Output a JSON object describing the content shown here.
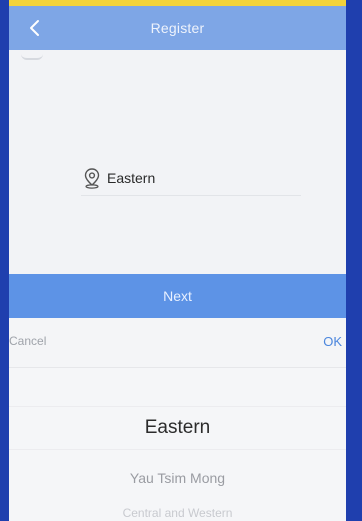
{
  "header": {
    "title": "Register"
  },
  "form": {
    "district_value": "Eastern"
  },
  "actions": {
    "next_label": "Next"
  },
  "picker": {
    "cancel_label": "Cancel",
    "ok_label": "OK",
    "options": [
      "Eastern",
      "Yau Tsim Mong",
      "Central and Western"
    ],
    "selected_index": 0
  },
  "icons": {
    "back": "chevron-left-icon",
    "location": "location-pin-icon"
  },
  "colors": {
    "frame": "#1f3fae",
    "frame_top": "#f3d33a",
    "header_bg": "#7ea6e6",
    "next_bg": "#5d93e6",
    "ok_color": "#4b86dd"
  }
}
